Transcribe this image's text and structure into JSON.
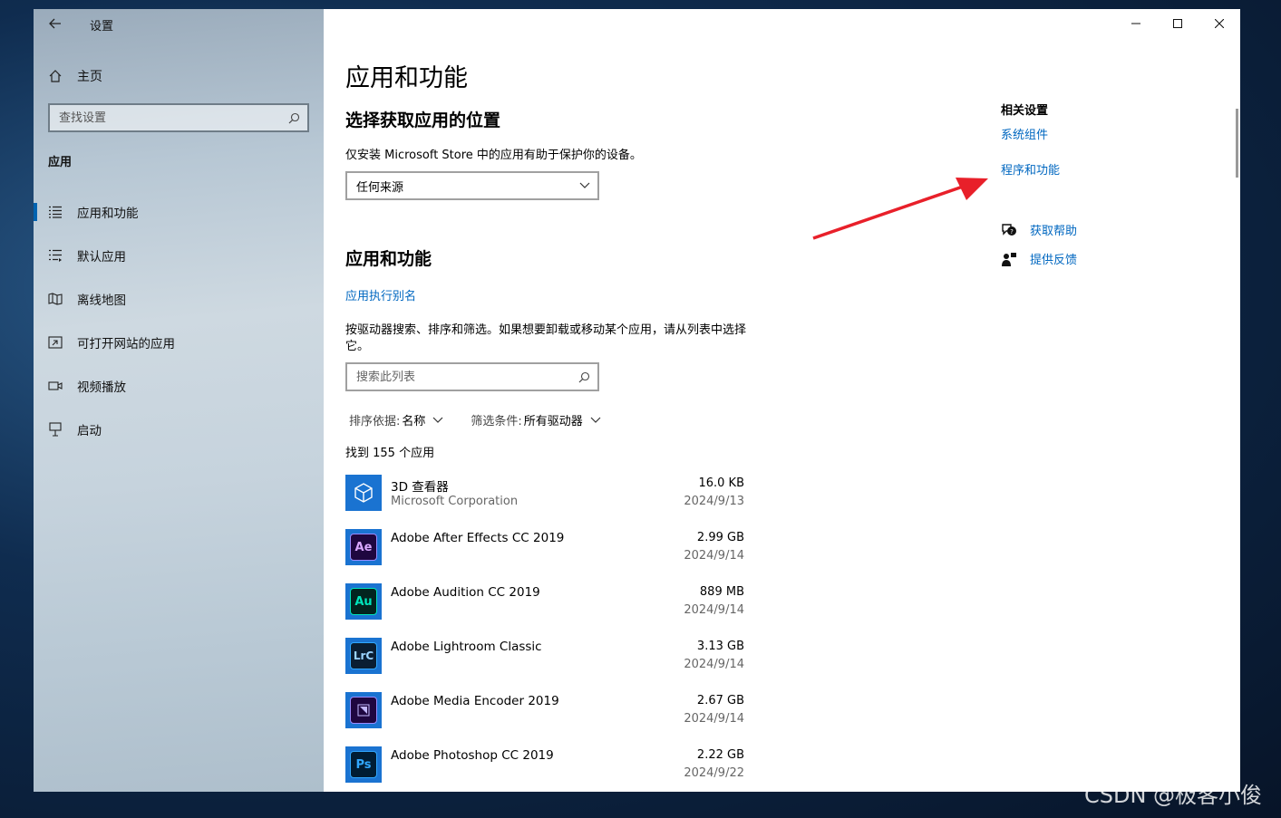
{
  "sidebar": {
    "app_title": "设置",
    "home_label": "主页",
    "search_placeholder": "查找设置",
    "section": "应用",
    "items": [
      {
        "label": "应用和功能",
        "icon": "apps-features-icon",
        "active": true
      },
      {
        "label": "默认应用",
        "icon": "default-apps-icon",
        "active": false
      },
      {
        "label": "离线地图",
        "icon": "offline-maps-icon",
        "active": false
      },
      {
        "label": "可打开网站的应用",
        "icon": "apps-for-websites-icon",
        "active": false
      },
      {
        "label": "视频播放",
        "icon": "video-playback-icon",
        "active": false
      },
      {
        "label": "启动",
        "icon": "startup-icon",
        "active": false
      }
    ]
  },
  "main": {
    "title": "应用和功能",
    "install_section": {
      "heading": "选择获取应用的位置",
      "description": "仅安装 Microsoft Store 中的应用有助于保护你的设备。",
      "dropdown_value": "任何来源"
    },
    "apps_section": {
      "heading": "应用和功能",
      "alias_link": "应用执行别名",
      "description": "按驱动器搜索、排序和筛选。如果想要卸载或移动某个应用，请从列表中选择它。",
      "search_placeholder": "搜索此列表",
      "sort_label": "排序依据:",
      "sort_value": "名称",
      "filter_label": "筛选条件:",
      "filter_value": "所有驱动器",
      "count_text": "找到 155 个应用"
    },
    "apps": [
      {
        "name": "3D 查看器",
        "publisher": "Microsoft Corporation",
        "size": "16.0 KB",
        "date": "2024/9/13",
        "icon": "3d-viewer-icon",
        "abbr": ""
      },
      {
        "name": "Adobe After Effects CC 2019",
        "publisher": "",
        "size": "2.99 GB",
        "date": "2024/9/14",
        "icon": "after-effects-icon",
        "abbr": "Ae"
      },
      {
        "name": "Adobe Audition CC 2019",
        "publisher": "",
        "size": "889 MB",
        "date": "2024/9/14",
        "icon": "audition-icon",
        "abbr": "Au"
      },
      {
        "name": "Adobe Lightroom Classic",
        "publisher": "",
        "size": "3.13 GB",
        "date": "2024/9/14",
        "icon": "lightroom-icon",
        "abbr": "LrC"
      },
      {
        "name": "Adobe Media Encoder 2019",
        "publisher": "",
        "size": "2.67 GB",
        "date": "2024/9/14",
        "icon": "media-encoder-icon",
        "abbr": ""
      },
      {
        "name": "Adobe Photoshop CC 2019",
        "publisher": "",
        "size": "2.22 GB",
        "date": "2024/9/22",
        "icon": "photoshop-icon",
        "abbr": "Ps"
      }
    ]
  },
  "related": {
    "title": "相关设置",
    "links": [
      "系统组件",
      "程序和功能"
    ],
    "help": "获取帮助",
    "feedback": "提供反馈"
  },
  "watermark": "CSDN @极客小俊",
  "colors": {
    "accent": "#0067c0",
    "annotation_arrow": "#e8202a"
  }
}
